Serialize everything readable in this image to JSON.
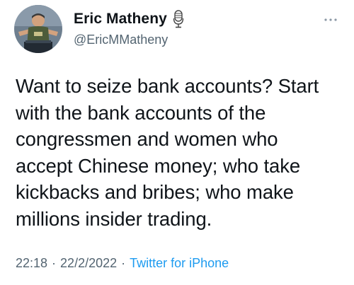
{
  "user": {
    "display_name": "Eric Matheny",
    "handle": "@EricMMatheny",
    "avatar_icon": "profile-photo",
    "badge_icon": "microphone-icon"
  },
  "menu": {
    "icon": "more-options-icon"
  },
  "tweet": {
    "text": "Want to seize bank accounts? Start\nwith the bank accounts of the\ncongressmen and women who\naccept Chinese money; who take\nkickbacks and bribes; who make\nmillions insider trading."
  },
  "meta": {
    "time": "22:18",
    "separator": "·",
    "date": "22/2/2022",
    "source": "Twitter for iPhone"
  },
  "colors": {
    "text": "#0f1419",
    "secondary": "#536471",
    "link": "#1d9bf0"
  }
}
